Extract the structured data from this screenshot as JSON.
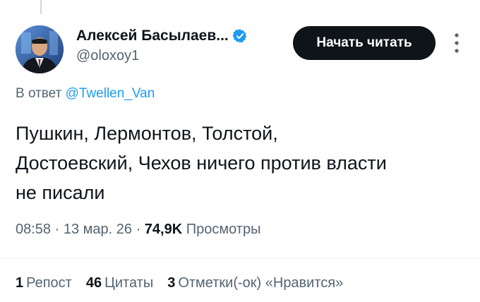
{
  "author": {
    "display_name": "Алексей Басылаев...",
    "handle": "@oloxoy1",
    "verified": true,
    "avatar_icon": "profile-photo"
  },
  "follow_button": {
    "label": "Начать читать"
  },
  "more_icon": "more-vertical-icon",
  "reply": {
    "prefix": "В ответ",
    "mention": "@Twellen_Van"
  },
  "tweet_text": "Пушкин, Лермонтов, Толстой,\nДостоевский, Чехов ничего против власти\nне писали",
  "meta": {
    "time": "08:58",
    "date": "13 мар. 26",
    "views_count": "74,9K",
    "views_label": "Просмотры"
  },
  "stats": {
    "reposts_count": "1",
    "reposts_label": "Репост",
    "quotes_count": "46",
    "quotes_label": "Цитаты",
    "likes_count": "3",
    "likes_label": "Отметки(-ок) «Нравится»"
  },
  "colors": {
    "text_primary": "#0f1419",
    "text_secondary": "#536471",
    "link": "#1d9bf0",
    "button_bg": "#0f1419",
    "verified": "#1d9bf0"
  }
}
